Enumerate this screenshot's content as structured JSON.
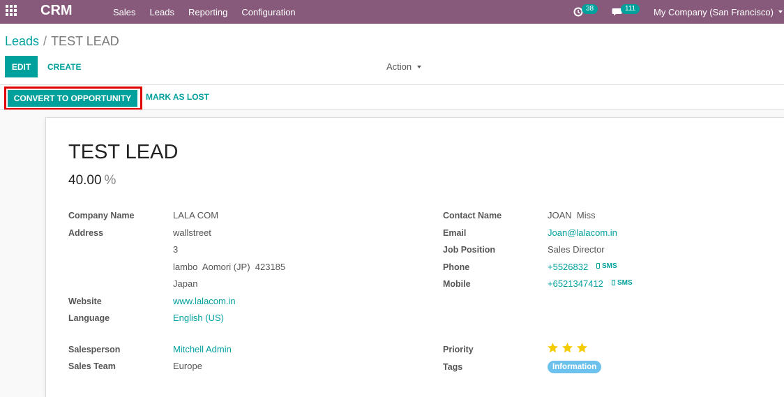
{
  "navbar": {
    "brand": "CRM",
    "menu": [
      "Sales",
      "Leads",
      "Reporting",
      "Configuration"
    ],
    "activity_count": "38",
    "message_count": "111",
    "company": "My Company (San Francisco)"
  },
  "breadcrumb": {
    "parent": "Leads",
    "separator": "/",
    "current": "TEST LEAD"
  },
  "toolbar": {
    "edit": "EDIT",
    "create": "CREATE",
    "action": "Action"
  },
  "statusbar": {
    "convert": "CONVERT TO OPPORTUNITY",
    "lost": "MARK AS LOST"
  },
  "lead": {
    "title": "TEST LEAD",
    "probability": "40.00",
    "probability_unit": "%",
    "labels": {
      "company": "Company Name",
      "address": "Address",
      "website": "Website",
      "language": "Language",
      "contact": "Contact Name",
      "email": "Email",
      "job": "Job Position",
      "phone": "Phone",
      "mobile": "Mobile",
      "salesperson": "Salesperson",
      "team": "Sales Team",
      "priority": "Priority",
      "tags": "Tags"
    },
    "company": "LALA COM",
    "address": [
      "wallstreet",
      "3",
      "lambo  Aomori (JP)  423185",
      "Japan"
    ],
    "website": "www.lalacom.in",
    "language": "English (US)",
    "contact": "JOAN  Miss",
    "email": "Joan@lalacom.in",
    "job": "Sales Director",
    "phone": "+5526832",
    "mobile": "+6521347412",
    "sms": "SMS",
    "salesperson": "Mitchell Admin",
    "team": "Europe",
    "priority_stars": 3,
    "tag": "Information"
  },
  "colors": {
    "primary": "#875a7b",
    "accent": "#00a09d",
    "star": "#f3cc00",
    "tag": "#6cc1ed",
    "highlight": "#e00000"
  }
}
